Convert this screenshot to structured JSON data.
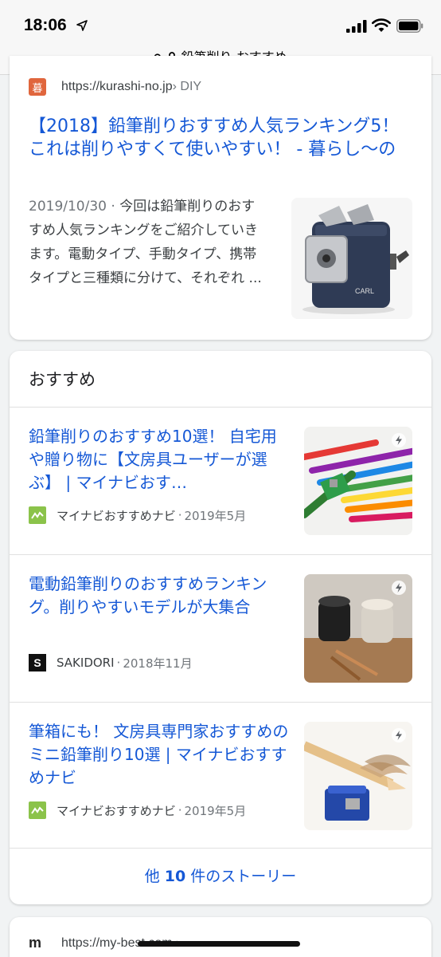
{
  "status": {
    "time": "18:06",
    "icons": [
      "location-arrow-icon",
      "signal-icon",
      "wifi-icon",
      "battery-icon"
    ]
  },
  "urlbar": {
    "query": "鉛筆削り おすすめ"
  },
  "result1": {
    "url": "https://kurashi-no.jp",
    "path": " › DIY",
    "favicon_char": "暮",
    "title": "【2018】鉛筆削りおすすめ人気ランキング5！これは削りやすくて使いやすい！ - 暮らし〜の",
    "date": "2019/10/30 · ",
    "snippet": "今回は鉛筆削りのおすすめ人気ランキングをご紹介していきます。電動タイプ、手動タイプ、携帯タイプと三種類に分けて、それぞれ ...",
    "thumb_logo": "CARL"
  },
  "top_stories": {
    "heading": "おすすめ",
    "stories": [
      {
        "title": "鉛筆削りのおすすめ10選！ 自宅用や贈り物に【文房具ユーザーが選ぶ】 | マイナビおす…",
        "source": "マイナビおすすめナビ",
        "date": "2019年5月"
      },
      {
        "title": "電動鉛筆削りのおすすめランキング。削りやすいモデルが大集合",
        "source": "SAKIDORI",
        "source_icon_char": "S",
        "date": "2018年11月"
      },
      {
        "title": "筆箱にも！ 文房具専門家おすすめのミニ鉛筆削り10選 | マイナビおすすめナビ",
        "source": "マイナビおすすめナビ",
        "date": "2019年5月"
      }
    ],
    "more_prefix": "他 ",
    "more_count": "10",
    "more_suffix": " 件のストーリー"
  },
  "result2": {
    "favicon_char": "m",
    "url": "https://my-best.com › ..."
  },
  "colors": {
    "link": "#1558d6",
    "kurashi_favicon": "#e0663d",
    "mynavi_favicon": "#8bc34a"
  }
}
